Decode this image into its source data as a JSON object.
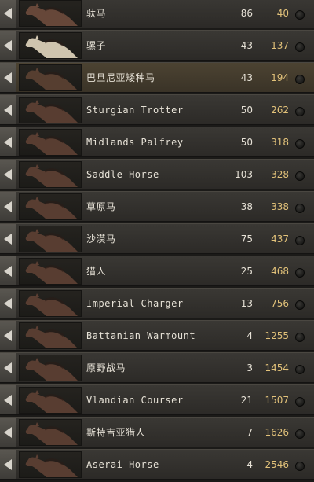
{
  "horses": [
    {
      "name": "驮马",
      "stat": "86",
      "price": "40",
      "coat": "#6a4a3b"
    },
    {
      "name": "骡子",
      "stat": "43",
      "price": "137",
      "coat": "#d9cdb6"
    },
    {
      "name": "巴旦尼亚矮种马",
      "stat": "43",
      "price": "194",
      "coat": "#5a4032"
    },
    {
      "name": "Sturgian Trotter",
      "stat": "50",
      "price": "262",
      "coat": "#5c3f33"
    },
    {
      "name": "Midlands Palfrey",
      "stat": "50",
      "price": "318",
      "coat": "#5c3f33"
    },
    {
      "name": "Saddle Horse",
      "stat": "103",
      "price": "328",
      "coat": "#5c3f33"
    },
    {
      "name": "草原马",
      "stat": "38",
      "price": "338",
      "coat": "#5c3f33"
    },
    {
      "name": "沙漠马",
      "stat": "75",
      "price": "437",
      "coat": "#5c3f33"
    },
    {
      "name": "猎人",
      "stat": "25",
      "price": "468",
      "coat": "#5c3f33"
    },
    {
      "name": "Imperial Charger",
      "stat": "13",
      "price": "756",
      "coat": "#5c3f33"
    },
    {
      "name": "Battanian Warmount",
      "stat": "4",
      "price": "1255",
      "coat": "#5c3f33"
    },
    {
      "name": "原野战马",
      "stat": "3",
      "price": "1454",
      "coat": "#5c3f33"
    },
    {
      "name": "Vlandian Courser",
      "stat": "21",
      "price": "1507",
      "coat": "#5c3f33"
    },
    {
      "name": "斯特吉亚猎人",
      "stat": "7",
      "price": "1626",
      "coat": "#5c3f33"
    },
    {
      "name": "Aserai Horse",
      "stat": "4",
      "price": "2546",
      "coat": "#5c3f33"
    }
  ],
  "highlighted_row": "巴旦尼亚矮种马",
  "colors": {
    "name_text": "#e6e1d6",
    "price_text": "#e2c27a",
    "row_bg": "#33312d",
    "highlight_bg": "#453c2e"
  }
}
